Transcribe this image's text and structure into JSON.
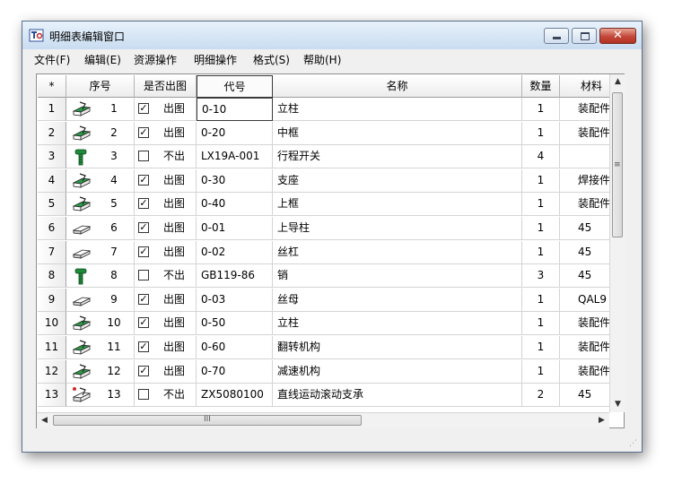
{
  "window": {
    "title": "明细表编辑窗口"
  },
  "menu": [
    "文件(F)",
    "编辑(E)",
    "资源操作",
    "明细操作",
    "格式(S)",
    "帮助(H)"
  ],
  "columns": [
    "*",
    "序号",
    "是否出图",
    "代号",
    "名称",
    "数量",
    "材料"
  ],
  "rows": [
    {
      "row": "1",
      "icon": "assembly-icon",
      "seq": "1",
      "checked": true,
      "draw": "出图",
      "code": "0-10",
      "name": "立柱",
      "qty": "1",
      "material": "装配件"
    },
    {
      "row": "2",
      "icon": "assembly-icon",
      "seq": "2",
      "checked": true,
      "draw": "出图",
      "code": "0-20",
      "name": "中框",
      "qty": "1",
      "material": "装配件"
    },
    {
      "row": "3",
      "icon": "standard-part-icon",
      "seq": "3",
      "checked": false,
      "draw": "不出",
      "code": "LX19A-001",
      "name": "行程开关",
      "qty": "4",
      "material": ""
    },
    {
      "row": "4",
      "icon": "assembly-icon",
      "seq": "4",
      "checked": true,
      "draw": "出图",
      "code": "0-30",
      "name": "支座",
      "qty": "1",
      "material": "焊接件"
    },
    {
      "row": "5",
      "icon": "assembly-icon",
      "seq": "5",
      "checked": true,
      "draw": "出图",
      "code": "0-40",
      "name": "上框",
      "qty": "1",
      "material": "装配件"
    },
    {
      "row": "6",
      "icon": "part-icon",
      "seq": "6",
      "checked": true,
      "draw": "出图",
      "code": "0-01",
      "name": "上导柱",
      "qty": "1",
      "material": "45"
    },
    {
      "row": "7",
      "icon": "part-icon",
      "seq": "7",
      "checked": true,
      "draw": "出图",
      "code": "0-02",
      "name": "丝杠",
      "qty": "1",
      "material": "45"
    },
    {
      "row": "8",
      "icon": "standard-part-icon",
      "seq": "8",
      "checked": false,
      "draw": "不出",
      "code": "GB119-86",
      "name": "销",
      "qty": "3",
      "material": "45"
    },
    {
      "row": "9",
      "icon": "part-icon",
      "seq": "9",
      "checked": true,
      "draw": "出图",
      "code": "0-03",
      "name": "丝母",
      "qty": "1",
      "material": "QAL9"
    },
    {
      "row": "10",
      "icon": "assembly-icon",
      "seq": "10",
      "checked": true,
      "draw": "出图",
      "code": "0-50",
      "name": "立柱",
      "qty": "1",
      "material": "装配件"
    },
    {
      "row": "11",
      "icon": "assembly-icon",
      "seq": "11",
      "checked": true,
      "draw": "出图",
      "code": "0-60",
      "name": "翻转机构",
      "qty": "1",
      "material": "装配件"
    },
    {
      "row": "12",
      "icon": "assembly-icon",
      "seq": "12",
      "checked": true,
      "draw": "出图",
      "code": "0-70",
      "name": "减速机构",
      "qty": "1",
      "material": "装配件"
    },
    {
      "row": "13",
      "icon": "purchased-assembly-icon",
      "seq": "13",
      "checked": false,
      "draw": "不出",
      "code": "ZX5080100",
      "name": "直线运动滚动支承",
      "qty": "2",
      "material": "45"
    }
  ],
  "scrollbar": {
    "grip": "III",
    "vgrip": "≡"
  },
  "colors": {
    "title_gradient_top": "#e8f2fb",
    "title_gradient_bottom": "#c9dcf0",
    "close_button": "#c3483a",
    "icon_green": "#1e8a3a"
  }
}
